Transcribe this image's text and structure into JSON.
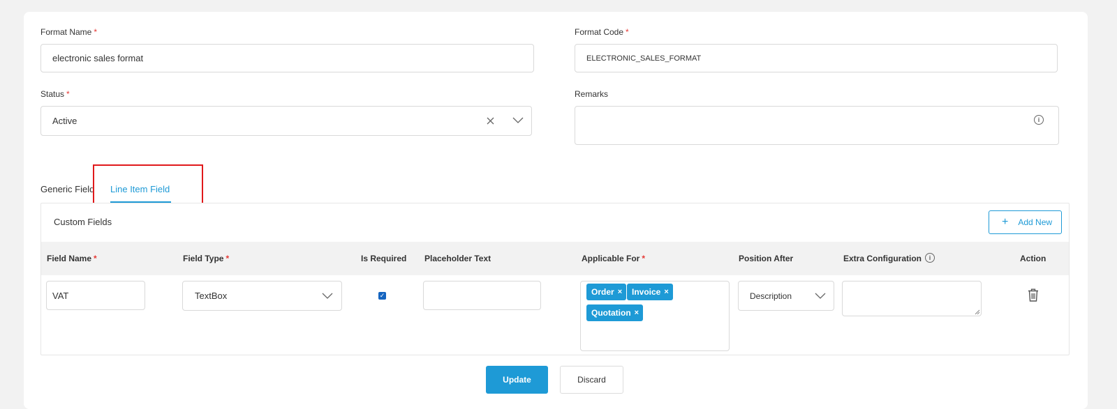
{
  "form": {
    "format_name": {
      "label": "Format Name",
      "required_mark": "*",
      "value": "electronic sales format"
    },
    "format_code": {
      "label": "Format Code",
      "required_mark": "*",
      "value": "ELECTRONIC_SALES_FORMAT"
    },
    "status": {
      "label": "Status",
      "required_mark": "*",
      "value": "Active",
      "clear_icon": "close-icon",
      "dropdown_icon": "chevron-down-icon"
    },
    "remarks": {
      "label": "Remarks",
      "value": "",
      "info_icon": "info-icon"
    }
  },
  "tabs": [
    {
      "label": "Generic Field",
      "active": false
    },
    {
      "label": "Line Item Field",
      "active": true
    }
  ],
  "custom_fields": {
    "title": "Custom Fields",
    "add_new_label": "Add New",
    "columns": {
      "field_name": "Field Name",
      "field_type": "Field Type",
      "is_required": "Is Required",
      "placeholder_text": "Placeholder Text",
      "applicable_for": "Applicable For",
      "position_after": "Position After",
      "extra_configuration": "Extra Configuration",
      "action": "Action"
    },
    "required_mark": "*",
    "rows": [
      {
        "field_name": "VAT",
        "field_type": "TextBox",
        "is_required": true,
        "placeholder_text": "",
        "applicable_for": [
          "Order",
          "Invoice",
          "Quotation"
        ],
        "tag_remove": "×",
        "position_after": "Description",
        "extra_configuration": "",
        "action_icon": "trash-icon"
      }
    ]
  },
  "footer": {
    "update_label": "Update",
    "discard_label": "Discard"
  },
  "colors": {
    "accent": "#1e9ad6",
    "required": "#e53935",
    "highlight": "#e0191b"
  }
}
